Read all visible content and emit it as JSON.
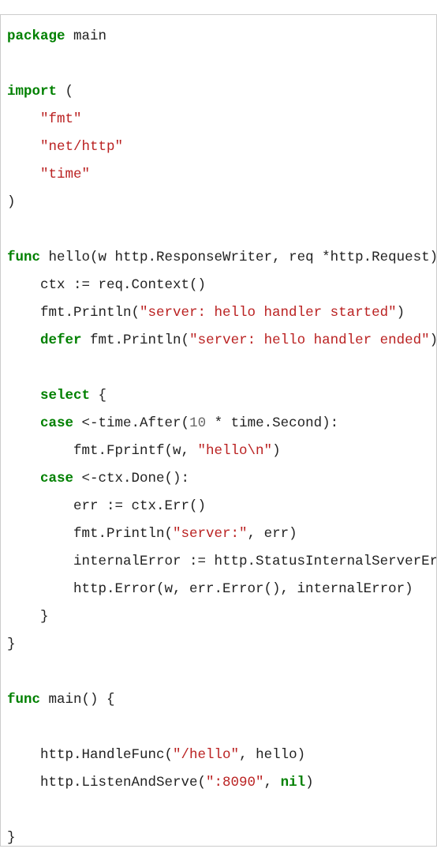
{
  "code": {
    "tokens": [
      {
        "cls": "kw",
        "t": "package"
      },
      {
        "t": " main\n"
      },
      {
        "t": "\n"
      },
      {
        "cls": "kw",
        "t": "import"
      },
      {
        "t": " (\n"
      },
      {
        "t": "    "
      },
      {
        "cls": "str",
        "t": "\"fmt\""
      },
      {
        "t": "\n"
      },
      {
        "t": "    "
      },
      {
        "cls": "str",
        "t": "\"net/http\""
      },
      {
        "t": "\n"
      },
      {
        "t": "    "
      },
      {
        "cls": "str",
        "t": "\"time\""
      },
      {
        "t": "\n"
      },
      {
        "t": ")\n"
      },
      {
        "t": "\n"
      },
      {
        "cls": "kw",
        "t": "func"
      },
      {
        "t": " hello(w http.ResponseWriter, req *http.Request) {\n"
      },
      {
        "t": "    ctx := req.Context()\n"
      },
      {
        "t": "    fmt.Println("
      },
      {
        "cls": "str",
        "t": "\"server: hello handler started\""
      },
      {
        "t": ")\n"
      },
      {
        "t": "    "
      },
      {
        "cls": "kw",
        "t": "defer"
      },
      {
        "t": " fmt.Println("
      },
      {
        "cls": "str",
        "t": "\"server: hello handler ended\""
      },
      {
        "t": ")\n"
      },
      {
        "t": "\n"
      },
      {
        "t": "    "
      },
      {
        "cls": "kw",
        "t": "select"
      },
      {
        "t": " {\n"
      },
      {
        "t": "    "
      },
      {
        "cls": "kw",
        "t": "case"
      },
      {
        "t": " <-time.After("
      },
      {
        "cls": "num",
        "t": "10"
      },
      {
        "t": " * time.Second):\n"
      },
      {
        "t": "        fmt.Fprintf(w, "
      },
      {
        "cls": "str",
        "t": "\"hello\\n\""
      },
      {
        "t": ")\n"
      },
      {
        "t": "    "
      },
      {
        "cls": "kw",
        "t": "case"
      },
      {
        "t": " <-ctx.Done():\n"
      },
      {
        "t": "        err := ctx.Err()\n"
      },
      {
        "t": "        fmt.Println("
      },
      {
        "cls": "str",
        "t": "\"server:\""
      },
      {
        "t": ", err)\n"
      },
      {
        "t": "        internalError := http.StatusInternalServerError\n"
      },
      {
        "t": "        http.Error(w, err.Error(), internalError)\n"
      },
      {
        "t": "    }\n"
      },
      {
        "t": "}\n"
      },
      {
        "t": "\n"
      },
      {
        "cls": "kw",
        "t": "func"
      },
      {
        "t": " main() {\n"
      },
      {
        "t": "\n"
      },
      {
        "t": "    http.HandleFunc("
      },
      {
        "cls": "str",
        "t": "\"/hello\""
      },
      {
        "t": ", hello)\n"
      },
      {
        "t": "    http.ListenAndServe("
      },
      {
        "cls": "str",
        "t": "\":8090\""
      },
      {
        "t": ", "
      },
      {
        "cls": "nil",
        "t": "nil"
      },
      {
        "t": ")\n"
      },
      {
        "t": "\n"
      },
      {
        "t": "}"
      }
    ]
  }
}
